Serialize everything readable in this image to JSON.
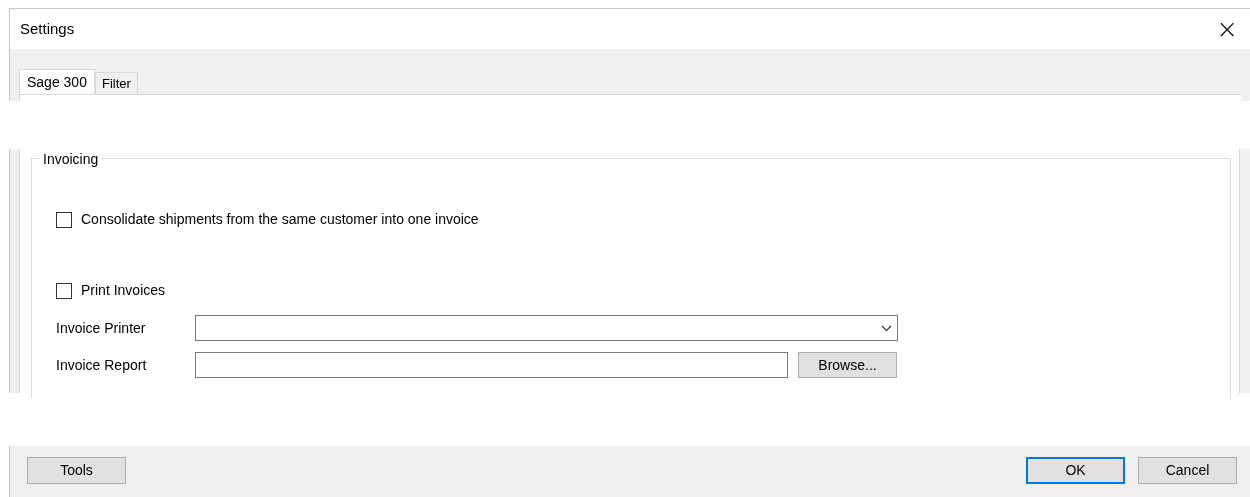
{
  "window": {
    "title": "Settings",
    "close": "×"
  },
  "tabs": [
    {
      "label": "Sage 300",
      "selected": true
    },
    {
      "label": "Filter",
      "selected": false
    }
  ],
  "group": {
    "title": "Invoicing"
  },
  "checkboxes": [
    {
      "label": "Consolidate shipments from the same customer into one invoice",
      "checked": false
    },
    {
      "label": "Print Invoices",
      "checked": false
    }
  ],
  "fields": [
    {
      "kind": "dropdown",
      "label": "Invoice Printer"
    },
    {
      "kind": "file",
      "label": "Invoice Report",
      "button": "Browse..."
    }
  ],
  "footer": {
    "left": [
      {
        "label": "Tools",
        "default": false
      }
    ],
    "right": [
      {
        "label": "OK",
        "default": true
      },
      {
        "label": "Cancel",
        "default": false
      }
    ]
  }
}
